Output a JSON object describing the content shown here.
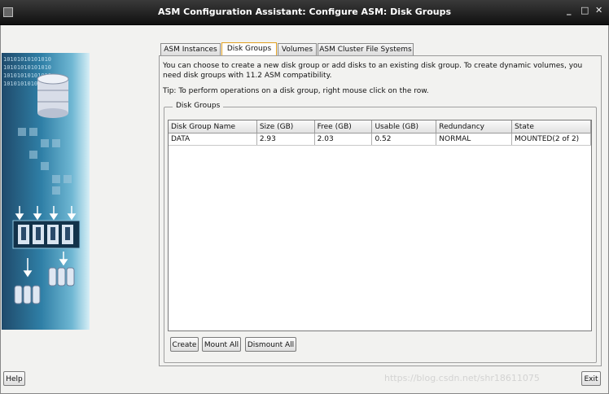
{
  "window": {
    "title": "ASM Configuration Assistant: Configure ASM: Disk Groups",
    "minimize_glyph": "_",
    "maximize_glyph": "□",
    "close_glyph": "✕"
  },
  "tabs": [
    {
      "label": "ASM Instances",
      "active": false
    },
    {
      "label": "Disk Groups",
      "active": true
    },
    {
      "label": "Volumes",
      "active": false
    },
    {
      "label": "ASM Cluster File Systems",
      "active": false
    }
  ],
  "description": "You can choose to create a new disk group or add disks to an existing disk group. To create dynamic volumes, you need disk groups with 11.2 ASM compatibility.",
  "tip": "Tip: To perform operations on a disk group, right mouse click on the row.",
  "disk_groups": {
    "legend": "Disk Groups",
    "columns": [
      "Disk Group Name",
      "Size (GB)",
      "Free (GB)",
      "Usable (GB)",
      "Redundancy",
      "State"
    ],
    "rows": [
      [
        "DATA",
        "2.93",
        "2.03",
        "0.52",
        "NORMAL",
        "MOUNTED(2 of 2)"
      ]
    ]
  },
  "buttons": {
    "create": "Create",
    "mount_all": "Mount All",
    "dismount_all": "Dismount All",
    "help": "Help",
    "exit": "Exit"
  },
  "side_art": {
    "binary_line": "10101010101010",
    "icon": "database-disk-illustration"
  },
  "watermark": "https://blog.csdn.net/shr18611075",
  "colors": {
    "titlebar": "#1a1a1a",
    "active_tab_border": "#e0a020",
    "art_primary": "#2f7fa6"
  }
}
